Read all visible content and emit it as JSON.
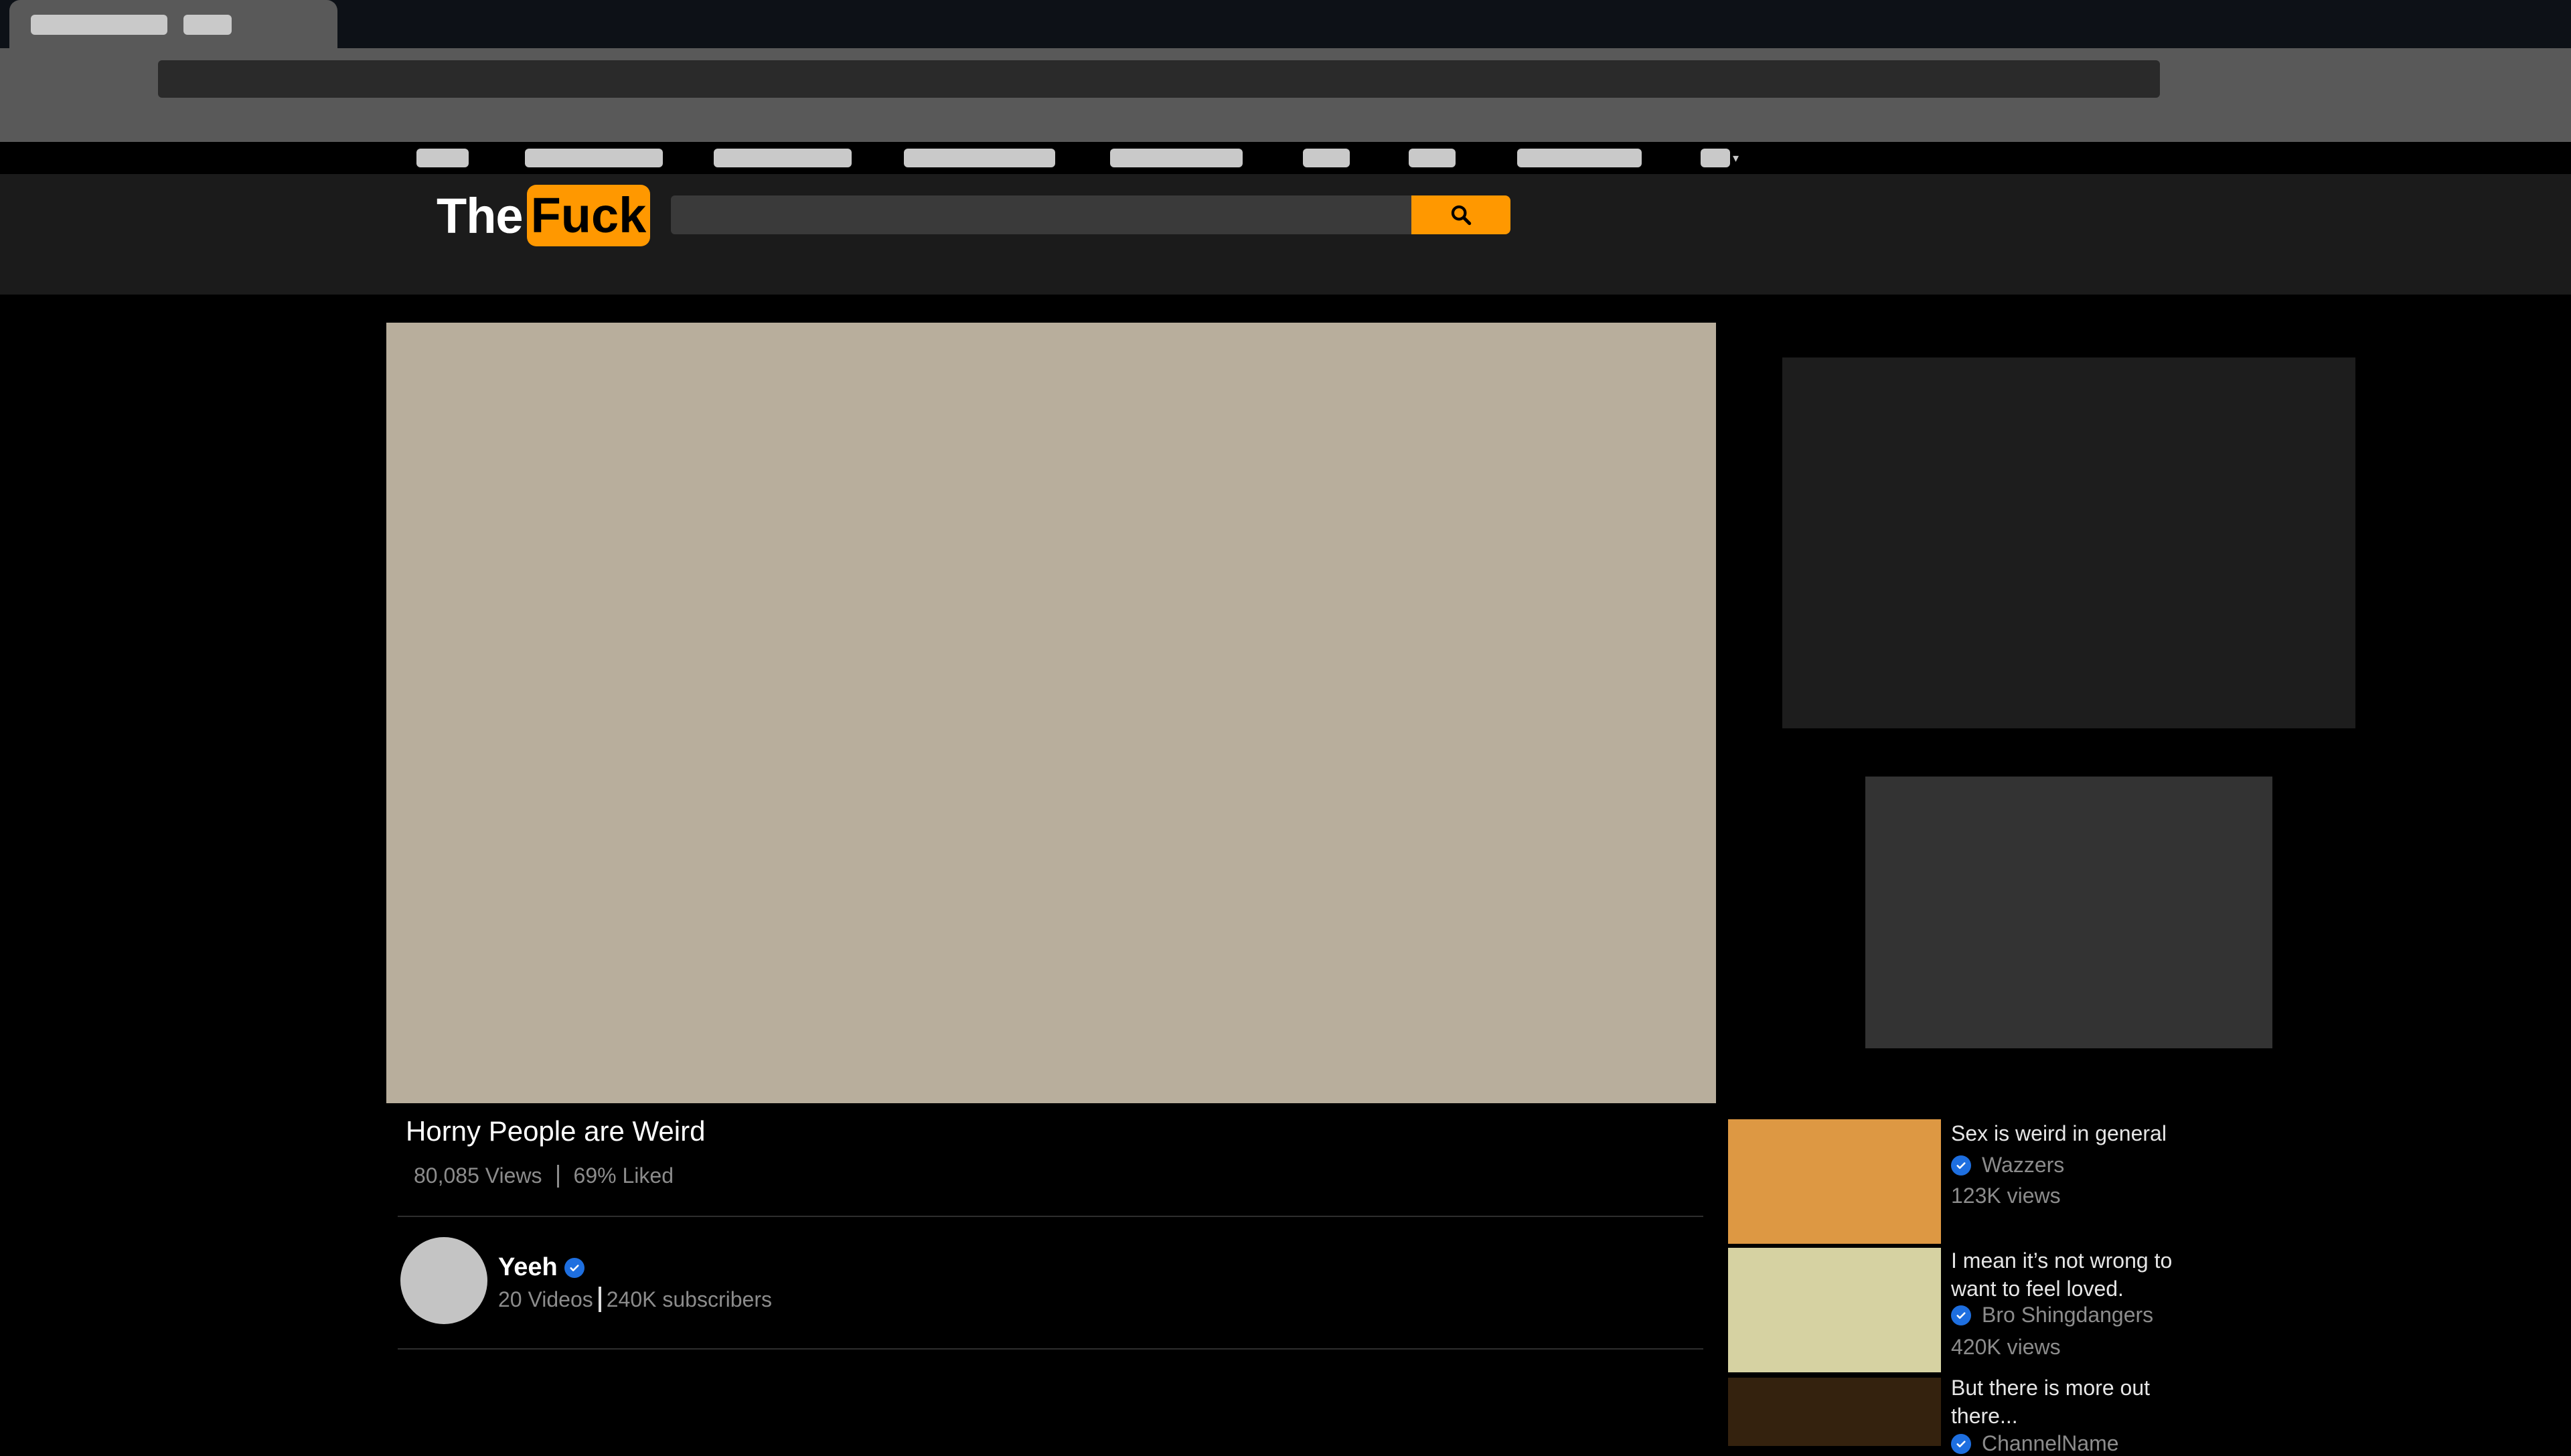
{
  "site": {
    "logo": {
      "part1": "The",
      "part2": "Fuck"
    },
    "colors": {
      "accent": "#ff9800",
      "header_bg": "#1b1b1b",
      "player_bg": "#b8ae9c",
      "verified": "#1e6fe0"
    }
  },
  "search": {
    "icon": "search-icon"
  },
  "video": {
    "title": "Horny People are Weird",
    "views": "80,085 Views",
    "liked": "69% Liked"
  },
  "channel": {
    "name": "Yeeh",
    "videos": "20 Videos",
    "subscribers": "240K subscribers"
  },
  "recommended": [
    {
      "title": "Sex is weird in general",
      "channel": "Wazzers",
      "views": "123K views",
      "thumb_color": "#dd9843"
    },
    {
      "title": "I mean it’s not wrong to want to feel loved.",
      "channel": "Bro Shingdangers",
      "views": "420K views",
      "thumb_color": "#d6d2a2"
    },
    {
      "title": "But there is more out there...",
      "channel": "ChannelName",
      "views": "",
      "thumb_color": "#34220e"
    }
  ]
}
